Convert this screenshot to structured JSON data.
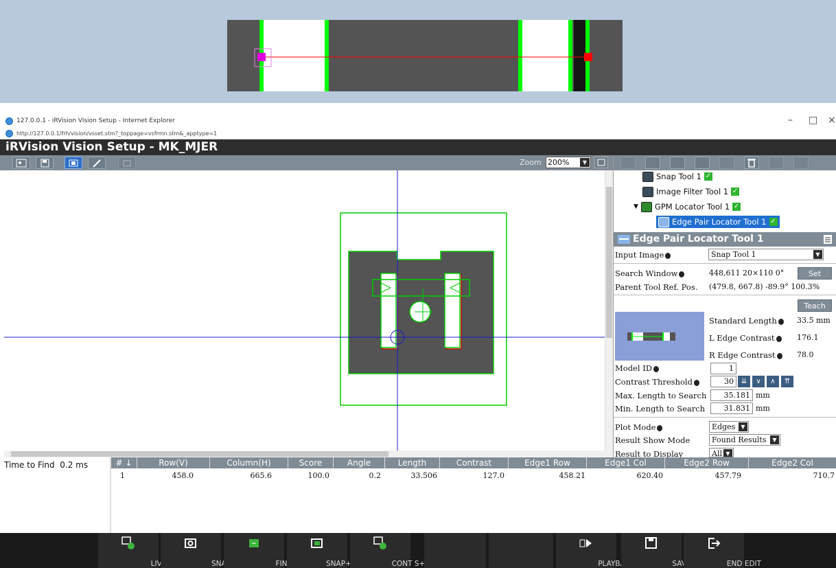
{
  "ie": {
    "title": "127.0.0.1 - iRVision Vision Setup - Internet Explorer",
    "url": "http://127.0.0.1/frh/vision/vsset.stm?_toppage=vsfrmn.stm&_apptype=1",
    "minimize": "–",
    "maximize": "□",
    "close": "×"
  },
  "app": {
    "title": "iRVision Vision Setup - MK_MJER"
  },
  "toolbar": {
    "zoom_label": "Zoom",
    "zoom_value": "200%"
  },
  "tree": {
    "items": [
      {
        "label": "Snap Tool 1"
      },
      {
        "label": "Image Filter Tool 1"
      },
      {
        "label": "GPM Locator Tool 1"
      },
      {
        "label": "Edge Pair Locator Tool 1"
      }
    ]
  },
  "panel": {
    "title": "Edge Pair Locator Tool 1",
    "input_image_label": "Input Image",
    "input_image_value": "Snap Tool 1",
    "search_window_label": "Search Window",
    "search_window_value": "448,611 20×110 0°",
    "set_button": "Set",
    "parent_ref_label": "Parent Tool Ref. Pos.",
    "parent_ref_value": "(479.8, 667.8) -89.9° 100.3%",
    "teach_button": "Teach",
    "std_length_label": "Standard Length",
    "std_length_value": "33.5 mm",
    "l_contrast_label": "L Edge Contrast",
    "l_contrast_value": "176.1",
    "r_contrast_label": "R Edge Contrast",
    "r_contrast_value": "78.0",
    "model_id_label": "Model ID",
    "model_id_value": "1",
    "contrast_thr_label": "Contrast Threshold",
    "contrast_thr_value": "30",
    "max_len_label": "Max. Length to Search",
    "max_len_value": "35.181",
    "min_len_label": "Min. Length to Search",
    "min_len_value": "31.831",
    "unit": "mm",
    "plot_mode_label": "Plot Mode",
    "plot_mode_value": "Edges",
    "result_show_label": "Result Show Mode",
    "result_show_value": "Found Results",
    "result_display_label": "Result to Display",
    "result_display_value": "All"
  },
  "results": {
    "time_label": "Time to Find",
    "time_value": "0.2 ms",
    "headers": [
      "#",
      "Row(V)",
      "Column(H)",
      "Score",
      "Angle",
      "Length",
      "Contrast",
      "Edge1 Row",
      "Edge1 Col",
      "Edge2 Row",
      "Edge2 Col"
    ],
    "rows": [
      [
        "1",
        "458.0",
        "665.6",
        "100.0",
        "0.2",
        "33.506",
        "127.0",
        "458.21",
        "620.40",
        "457.79",
        "710.7"
      ]
    ]
  },
  "commands": [
    "LIVE",
    "SNAP",
    "FIND",
    "SNAP+FIND",
    "CONT S+F",
    "PLAYBACK",
    "SAVE",
    "END EDIT"
  ],
  "colors": {
    "toolbar": "#7f8b95",
    "title_bar": "#2d2d2d",
    "selection": "#1f6fd0",
    "edge_green": "#00ff00",
    "crosshair": "#1a1acc"
  }
}
